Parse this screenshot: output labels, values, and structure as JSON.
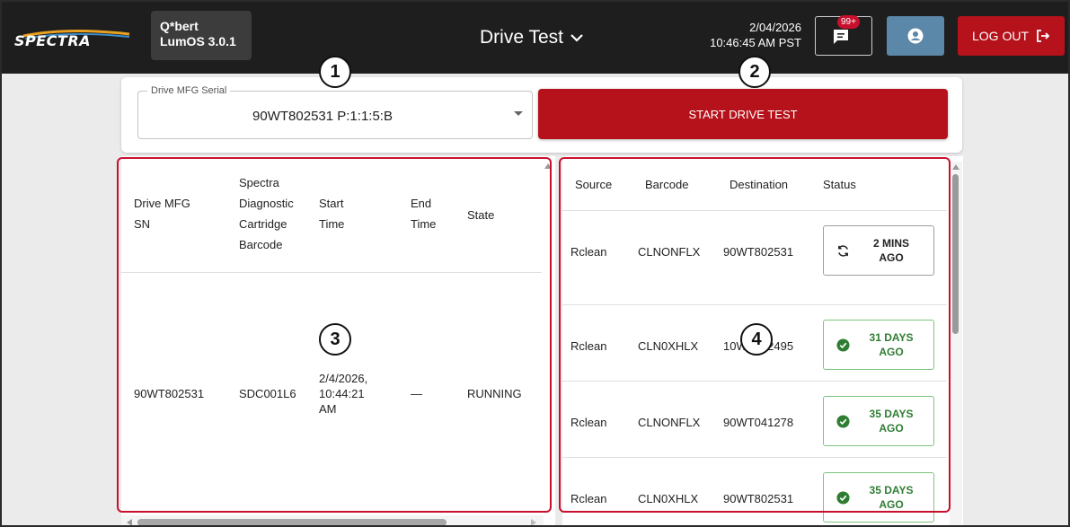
{
  "header": {
    "brand": "SPECTRA",
    "product_line1": "Q*bert",
    "product_line2": "LumOS 3.0.1",
    "title": "Drive Test",
    "date": "2/04/2026",
    "time": "10:46:45 AM PST",
    "messages_badge": "99+",
    "logout_label": "LOG OUT"
  },
  "selector": {
    "label": "Drive MFG Serial",
    "value": "90WT802531 P:1:1:5:B",
    "start_button": "START DRIVE TEST"
  },
  "test_table": {
    "headers": {
      "drive_sn": [
        "Drive MFG",
        "SN"
      ],
      "barcode": [
        "Spectra",
        "Diagnostic",
        "Cartridge",
        "Barcode"
      ],
      "start": [
        "Start",
        "Time"
      ],
      "end": [
        "End",
        "Time"
      ],
      "state": "State"
    },
    "rows": [
      {
        "drive_sn": "90WT802531",
        "barcode": "SDC001L6",
        "start": [
          "2/4/2026,",
          "10:44:21",
          "AM"
        ],
        "end": "—",
        "state": "RUNNING"
      }
    ]
  },
  "moves_table": {
    "headers": [
      "Source",
      "Barcode",
      "Destination",
      "Status"
    ],
    "rows": [
      {
        "source": "Rclean",
        "barcode": "CLNONFLX",
        "destination": "90WT802531",
        "status": [
          "2 MINS",
          "AGO"
        ],
        "status_icon": "sync-icon",
        "state": "pending"
      },
      {
        "source": "Rclean",
        "barcode": "CLN0XHLX",
        "destination": "10WT002495",
        "status": [
          "31 DAYS",
          "AGO"
        ],
        "status_icon": "check-circle-icon",
        "state": "done"
      },
      {
        "source": "Rclean",
        "barcode": "CLNONFLX",
        "destination": "90WT041278",
        "status": [
          "35 DAYS",
          "AGO"
        ],
        "status_icon": "check-circle-icon",
        "state": "done"
      },
      {
        "source": "Rclean",
        "barcode": "CLN0XHLX",
        "destination": "90WT802531",
        "status": [
          "35 DAYS",
          "AGO"
        ],
        "status_icon": "check-circle-icon",
        "state": "done"
      }
    ]
  },
  "callouts": [
    "1",
    "2",
    "3",
    "4"
  ],
  "colors": {
    "topbar": "#1e1e1e",
    "accent_red": "#b5121b",
    "user_button": "#5b87a8",
    "success_green": "#2e7d32",
    "callout_red": "#c8102e"
  }
}
